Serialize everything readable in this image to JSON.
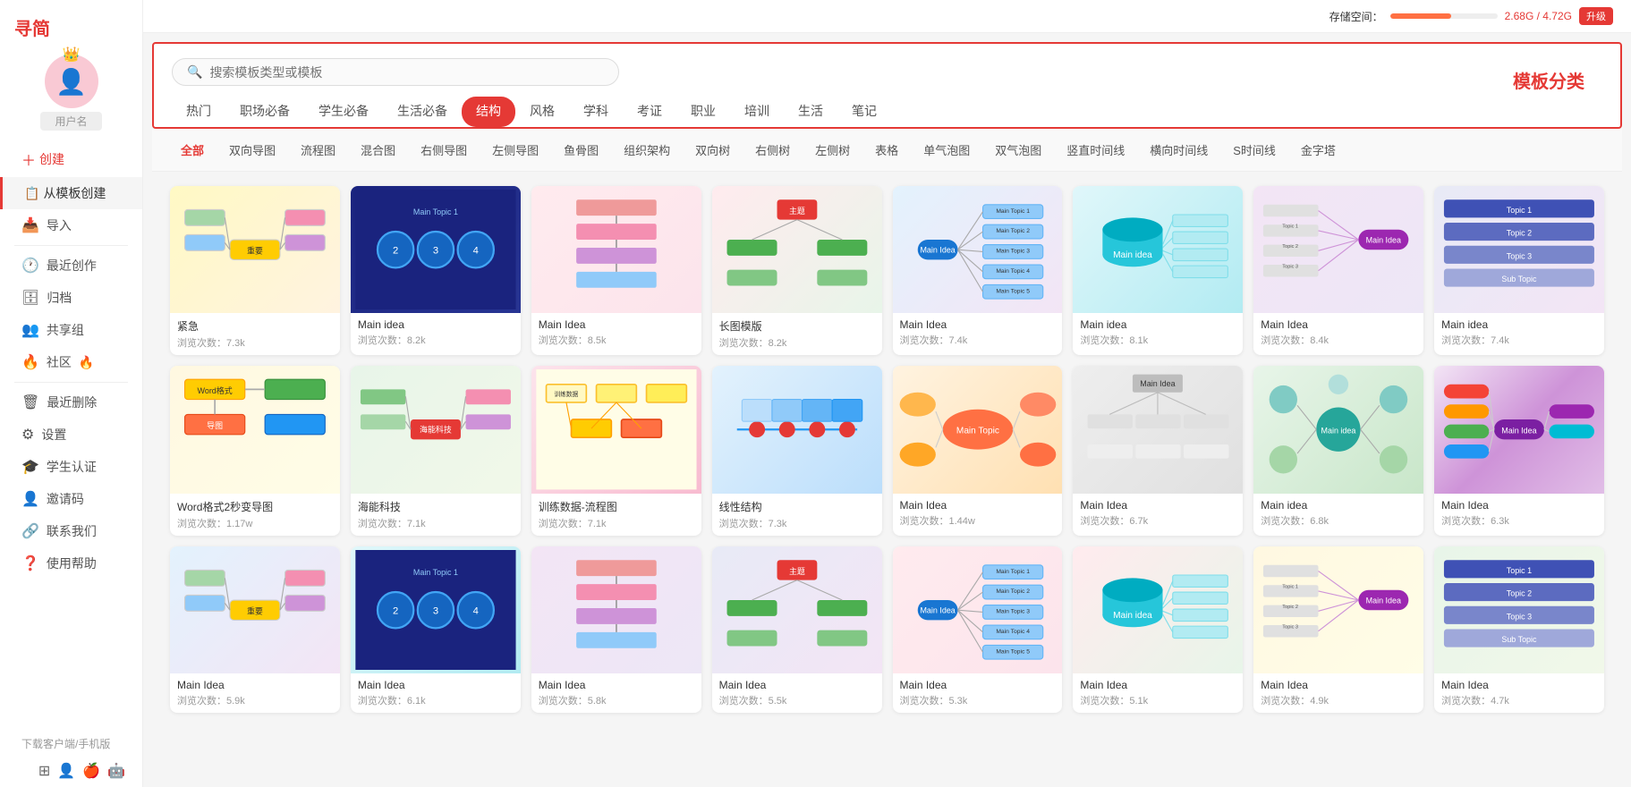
{
  "app": {
    "name": "寻简",
    "storage_label": "存储空间：",
    "storage_used": "2.68G / 4.72G",
    "upgrade_label": "升级"
  },
  "sidebar": {
    "username": "用户名",
    "create_label": "创建",
    "from_template_label": "从模板创建",
    "import_label": "导入",
    "recent_label": "最近创作",
    "archive_label": "归档",
    "share_group_label": "共享组",
    "community_label": "社区",
    "recent_delete_label": "最近删除",
    "settings_label": "设置",
    "student_label": "学生认证",
    "invite_label": "邀请码",
    "contact_label": "联系我们",
    "help_label": "使用帮助",
    "download_label": "下载客户端/手机版"
  },
  "search": {
    "placeholder": "搜索模板类型或模板"
  },
  "category_title": "模板分类",
  "filter_tabs": [
    {
      "label": "热门",
      "active": false
    },
    {
      "label": "职场必备",
      "active": false
    },
    {
      "label": "学生必备",
      "active": false
    },
    {
      "label": "生活必备",
      "active": false
    },
    {
      "label": "结构",
      "active": true
    },
    {
      "label": "风格",
      "active": false
    },
    {
      "label": "学科",
      "active": false
    },
    {
      "label": "考证",
      "active": false
    },
    {
      "label": "职业",
      "active": false
    },
    {
      "label": "培训",
      "active": false
    },
    {
      "label": "生活",
      "active": false
    },
    {
      "label": "笔记",
      "active": false
    }
  ],
  "sub_categories": [
    {
      "label": "全部",
      "active": true
    },
    {
      "label": "双向导图",
      "active": false
    },
    {
      "label": "流程图",
      "active": false
    },
    {
      "label": "混合图",
      "active": false
    },
    {
      "label": "右侧导图",
      "active": false
    },
    {
      "label": "左侧导图",
      "active": false
    },
    {
      "label": "鱼骨图",
      "active": false
    },
    {
      "label": "组织架构",
      "active": false
    },
    {
      "label": "双向树",
      "active": false
    },
    {
      "label": "右侧树",
      "active": false
    },
    {
      "label": "左侧树",
      "active": false
    },
    {
      "label": "表格",
      "active": false
    },
    {
      "label": "单气泡图",
      "active": false
    },
    {
      "label": "双气泡图",
      "active": false
    },
    {
      "label": "竖直时间线",
      "active": false
    },
    {
      "label": "横向时间线",
      "active": false
    },
    {
      "label": "S时间线",
      "active": false
    },
    {
      "label": "金字塔",
      "active": false
    }
  ],
  "templates": [
    {
      "title": "紧急",
      "views": "浏览次数：7.3k",
      "thumb_class": "thumb-1"
    },
    {
      "title": "Main idea",
      "views": "浏览次数：8.2k",
      "thumb_class": "thumb-2"
    },
    {
      "title": "Main Idea",
      "views": "浏览次数：8.5k",
      "thumb_class": "thumb-3"
    },
    {
      "title": "长图模版",
      "views": "浏览次数：8.2k",
      "thumb_class": "thumb-4"
    },
    {
      "title": "Main Idea",
      "views": "浏览次数：7.4k",
      "thumb_class": "thumb-5"
    },
    {
      "title": "Main idea",
      "views": "浏览次数：8.1k",
      "thumb_class": "thumb-6"
    },
    {
      "title": "Main Idea",
      "views": "浏览次数：8.4k",
      "thumb_class": "thumb-7"
    },
    {
      "title": "Main idea",
      "views": "浏览次数：7.4k",
      "thumb_class": "thumb-8"
    },
    {
      "title": "Word格式2秒变导图",
      "views": "浏览次数：1.17w",
      "thumb_class": "thumb-9"
    },
    {
      "title": "海能科技",
      "views": "浏览次数：7.1k",
      "thumb_class": "thumb-10"
    },
    {
      "title": "训练数据-流程图",
      "views": "浏览次数：7.1k",
      "thumb_class": "thumb-11"
    },
    {
      "title": "线性结构",
      "views": "浏览次数：7.3k",
      "thumb_class": "thumb-12"
    },
    {
      "title": "Main Idea",
      "views": "浏览次数：1.44w",
      "thumb_class": "thumb-13"
    },
    {
      "title": "Main Idea",
      "views": "浏览次数：6.7k",
      "thumb_class": "thumb-14"
    },
    {
      "title": "Main idea",
      "views": "浏览次数：6.8k",
      "thumb_class": "thumb-15"
    },
    {
      "title": "Main Idea",
      "views": "浏览次数：6.3k",
      "thumb_class": "thumb-16"
    },
    {
      "title": "Main Idea",
      "views": "浏览次数：5.9k",
      "thumb_class": "thumb-5"
    },
    {
      "title": "Main Idea",
      "views": "浏览次数：6.1k",
      "thumb_class": "thumb-6"
    },
    {
      "title": "Main Idea",
      "views": "浏览次数：5.8k",
      "thumb_class": "thumb-7"
    },
    {
      "title": "Main Idea",
      "views": "浏览次数：5.5k",
      "thumb_class": "thumb-8"
    },
    {
      "title": "Main Idea",
      "views": "浏览次数：5.3k",
      "thumb_class": "thumb-3"
    },
    {
      "title": "Main Idea",
      "views": "浏览次数：5.1k",
      "thumb_class": "thumb-4"
    },
    {
      "title": "Main Idea",
      "views": "浏览次数：4.9k",
      "thumb_class": "thumb-9"
    },
    {
      "title": "Main Idea",
      "views": "浏览次数：4.7k",
      "thumb_class": "thumb-10"
    }
  ]
}
